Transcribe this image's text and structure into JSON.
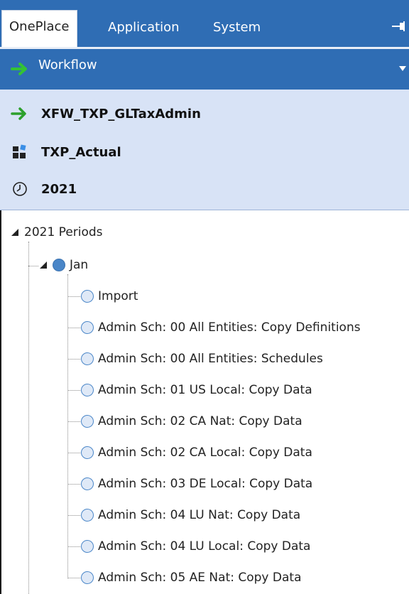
{
  "tabs": [
    {
      "label": "OnePlace",
      "active": true
    },
    {
      "label": "Application",
      "active": false
    },
    {
      "label": "System",
      "active": false
    }
  ],
  "workflow_bar": {
    "label": "Workflow",
    "icon": "green-arrow-icon"
  },
  "pov": {
    "workflow": "XFW_TXP_GLTaxAdmin",
    "scenario": "TXP_Actual",
    "time": "2021"
  },
  "tree": {
    "root": "2021 Periods",
    "period": "Jan",
    "steps": [
      "Import",
      "Admin Sch: 00 All Entities: Copy Definitions",
      "Admin Sch: 00 All Entities: Schedules",
      "Admin Sch: 01 US Local: Copy Data",
      "Admin Sch: 02 CA Nat: Copy Data",
      "Admin Sch: 02 CA Local: Copy Data",
      "Admin Sch: 03 DE Local: Copy Data",
      "Admin Sch: 04 LU Nat: Copy Data",
      "Admin Sch: 04 LU Local: Copy Data",
      "Admin Sch: 05 AE Nat: Copy Data"
    ]
  },
  "colors": {
    "accent": "#2f6db4",
    "pov_bg": "#d8e3f6",
    "status_circle": "#4a86c8",
    "arrow_green": "#2ca02c"
  }
}
